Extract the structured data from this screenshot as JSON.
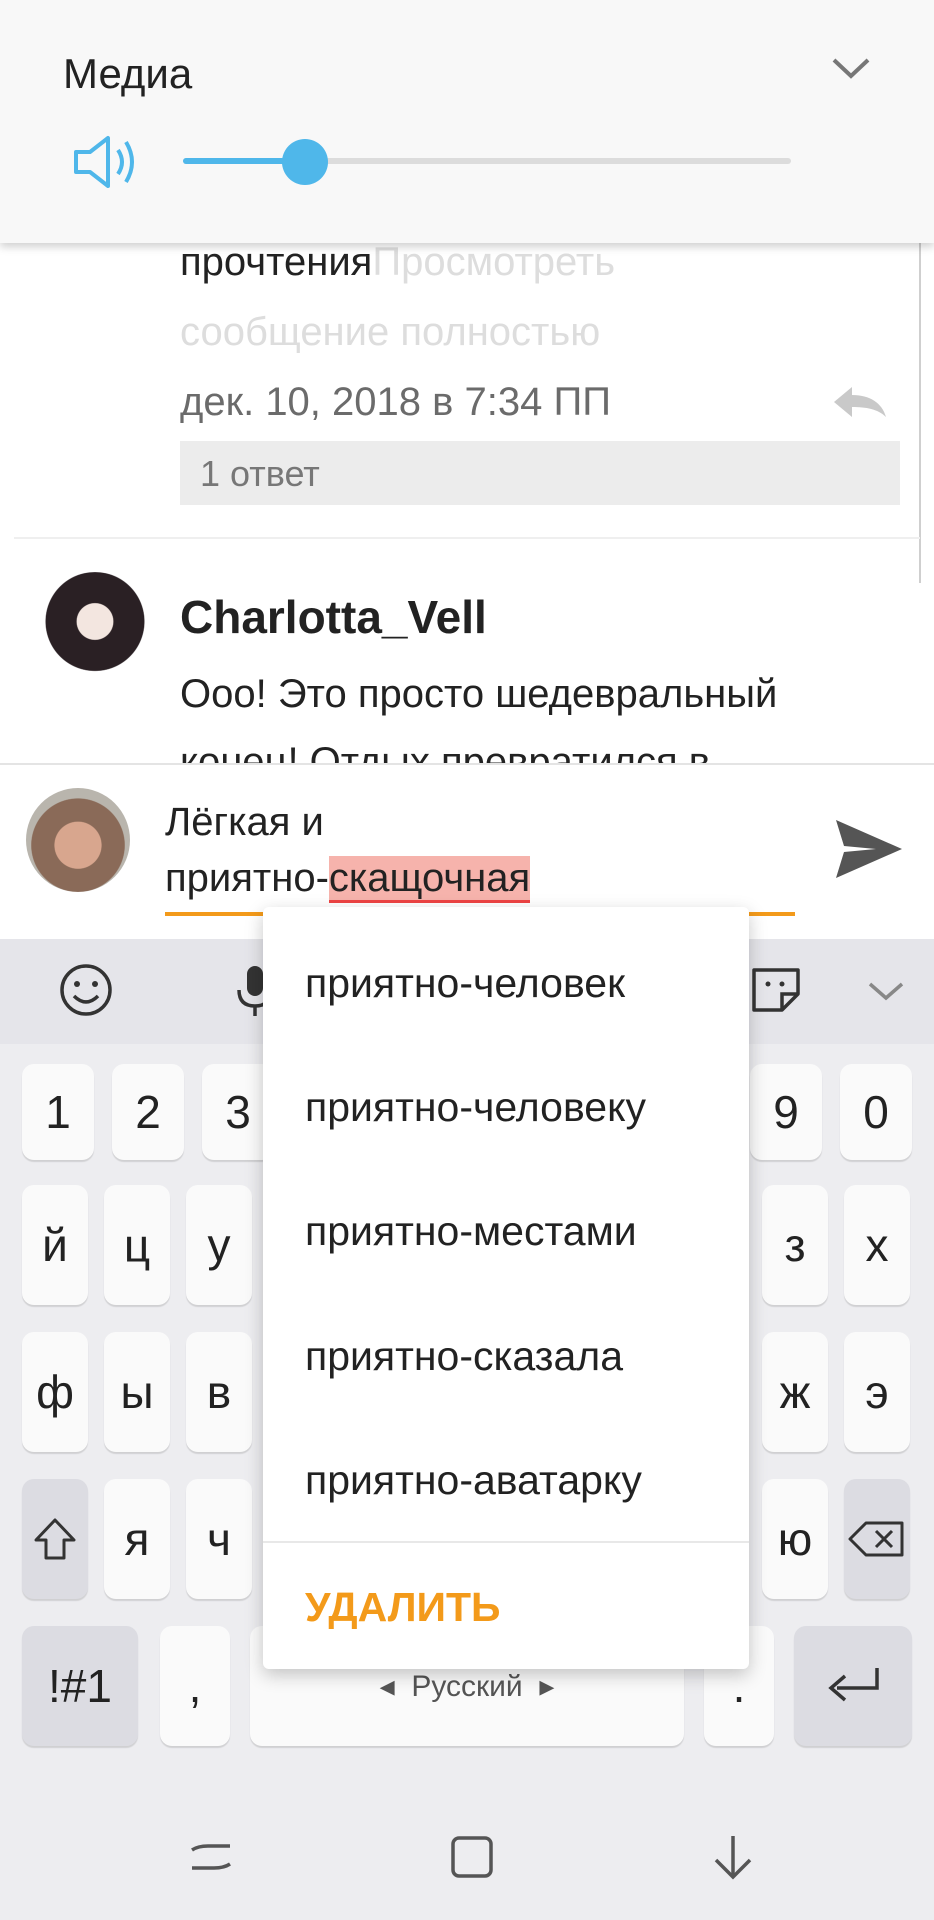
{
  "media_panel": {
    "title": "Медиа",
    "volume_level": 0.2,
    "accent_color": "#4fb7ea"
  },
  "comments": [
    {
      "text_line1": "прочтения",
      "text_line1_faded": "Просмотреть",
      "text_line2_faded": "сообщение полностью",
      "date": "дек. 10, 2018 в 7:34 ПП",
      "replies_label": "1 ответ"
    },
    {
      "author": "Charlotta_Vell",
      "text_line1": "Ооо! Это просто шедевральный",
      "text_line2": "конец! Отдых превратился в"
    }
  ],
  "input": {
    "line1": "Лёгкая и",
    "line2_prefix": "приятно-",
    "line2_misspelled": "скащочная",
    "underline_color": "#f39a1a"
  },
  "suggestions": {
    "items": [
      "приятно-человек",
      "приятно-человеку",
      "приятно-местами",
      "приятно-сказала",
      "приятно-аватарку"
    ],
    "delete_label": "УДАЛИТЬ"
  },
  "keyboard": {
    "row_numbers_left": [
      "1",
      "2",
      "3"
    ],
    "row_numbers_right": [
      "9",
      "0"
    ],
    "row1_left": [
      "й",
      "ц",
      "у"
    ],
    "row1_right": [
      "з",
      "х"
    ],
    "row2_left": [
      "ф",
      "ы",
      "в"
    ],
    "row2_right": [
      "ж",
      "э"
    ],
    "row3_left": [
      "я",
      "ч"
    ],
    "row3_right": [
      "ю"
    ],
    "symbols_label": "!#1",
    "comma_label": ",",
    "space_label": "Русский",
    "period_label": ".",
    "toolbar_icons": [
      "emoji-icon",
      "microphone-icon",
      "sticker-icon",
      "chevron-down-icon"
    ]
  },
  "navbar": {
    "icons": [
      "recent-apps-icon",
      "home-icon",
      "back-icon"
    ]
  }
}
